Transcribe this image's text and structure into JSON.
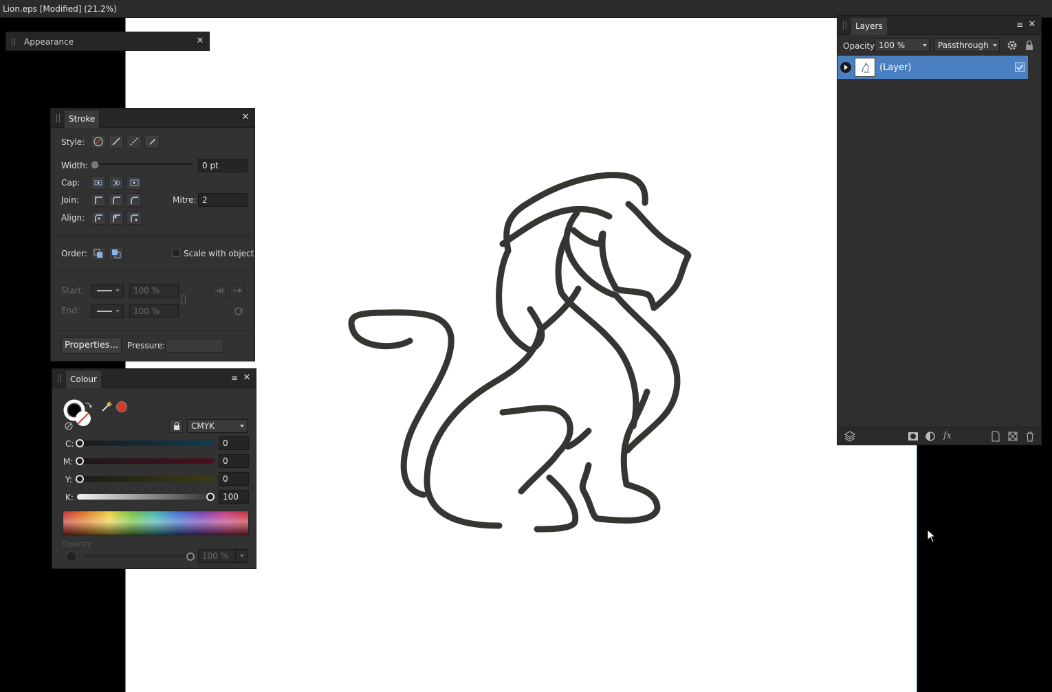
{
  "window": {
    "title": "Lion.eps [Modified] (21.2%)"
  },
  "appearance": {
    "tab": "Appearance"
  },
  "stroke": {
    "tab": "Stroke",
    "style_label": "Style:",
    "width_label": "Width:",
    "width_value": "0 pt",
    "cap_label": "Cap:",
    "join_label": "Join:",
    "mitre_label": "Mitre:",
    "mitre_value": "2",
    "align_label": "Align:",
    "order_label": "Order:",
    "scale_label": "Scale with object",
    "start_label": "Start:",
    "end_label": "End:",
    "start_pct": "100 %",
    "end_pct": "100 %",
    "properties_label": "Properties...",
    "pressure_label": "Pressure:"
  },
  "colour": {
    "tab": "Colour",
    "model": "CMYK",
    "c_label": "C:",
    "c_value": "0",
    "m_label": "M:",
    "m_value": "0",
    "y_label": "Y:",
    "y_value": "0",
    "k_label": "K:",
    "k_value": "100",
    "opacity_label": "Opacity",
    "opacity_value": "100 %",
    "accent": "#d23a2a"
  },
  "layers": {
    "tab": "Layers",
    "opacity_label": "Opacity:",
    "opacity_value": "100 %",
    "blend_mode": "Passthrough",
    "items": [
      {
        "name": "(Layer)",
        "visible": true
      }
    ],
    "selection_color": "#4a7fc1"
  }
}
